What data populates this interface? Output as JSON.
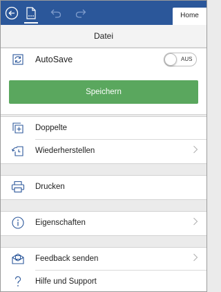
{
  "toolbar": {
    "back_icon": "circle-arrow-left-icon",
    "file_icon": "document-icon",
    "undo_icon": "undo-icon",
    "redo_icon": "redo-icon",
    "home_tab": "Home",
    "color_bar": "#2b579a"
  },
  "panel": {
    "title": "Datei"
  },
  "autosave": {
    "label": "AutoSave",
    "toggle_label": "AUS",
    "state": "off"
  },
  "save": {
    "label": "Speichern",
    "color": "#5aa75e"
  },
  "menu": {
    "duplicate": "Doppelte",
    "restore": "Wiederherstellen",
    "print": "Drucken",
    "properties": "Eigenschaften",
    "feedback": "Feedback senden",
    "help": "Hilfe und Support"
  }
}
